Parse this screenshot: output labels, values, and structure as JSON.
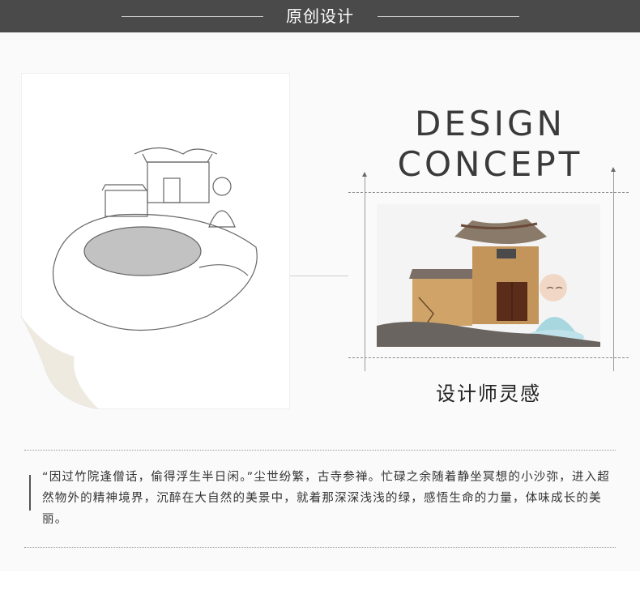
{
  "header": {
    "title": "原创设计"
  },
  "concept": {
    "line1": "DESIGN",
    "line2": "CONCEPT"
  },
  "caption": "设计师灵感",
  "quote": "“因过竹院逢僧话，偷得浮生半日闲。”尘世纷繁，古寺参禅。忙碌之余随着静坐冥想的小沙弥，进入超然物外的精神境界，沉醉在大自然的美景中，就着那深深浅浅的绿，感悟生命的力量，体味成长的美丽。",
  "colors": {
    "header_bg": "#4a4a4a",
    "panel_bg": "#fafafa",
    "text": "#333333"
  }
}
